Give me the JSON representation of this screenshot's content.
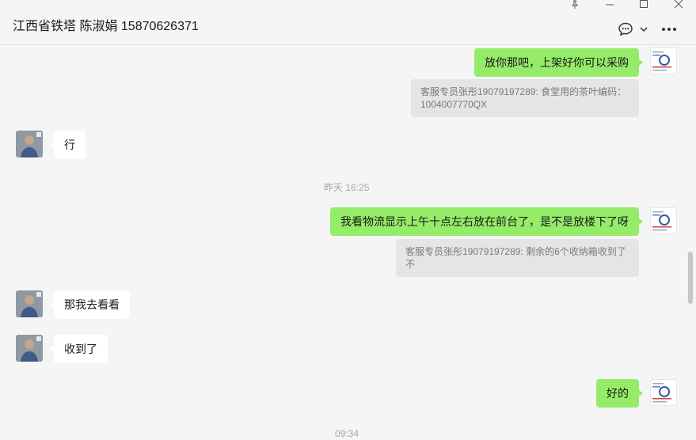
{
  "header": {
    "title": "江西省铁塔 陈淑娟 15870626371",
    "window_controls": [
      "pin-icon",
      "minimize-icon",
      "maximize-icon",
      "close-icon"
    ],
    "actions": [
      "chat-bubble-icon",
      "chevron-down-icon",
      "more-icon"
    ]
  },
  "messages": [
    {
      "sender": "self",
      "text": "放你那吧，上架好你可以采购",
      "quote": "客服专员张彤19079197289: 食堂用的茶叶编码：1004007770QX"
    },
    {
      "sender": "contact",
      "text": "行"
    },
    {
      "type": "time",
      "text": "昨天 16:25"
    },
    {
      "sender": "self",
      "text": "我看物流显示上午十点左右放在前台了，是不是放楼下了呀",
      "quote": "客服专员张彤19079197289: 剩余的6个收纳箱收到了不"
    },
    {
      "sender": "contact",
      "text": "那我去看看"
    },
    {
      "sender": "contact",
      "text": "收到了"
    },
    {
      "sender": "self",
      "text": "好的"
    },
    {
      "type": "time",
      "text": "09:34"
    }
  ],
  "colors": {
    "self_bubble": "#95ec69",
    "other_bubble": "#ffffff",
    "quote_bg": "#e5e5e5",
    "background": "#f5f5f5"
  }
}
